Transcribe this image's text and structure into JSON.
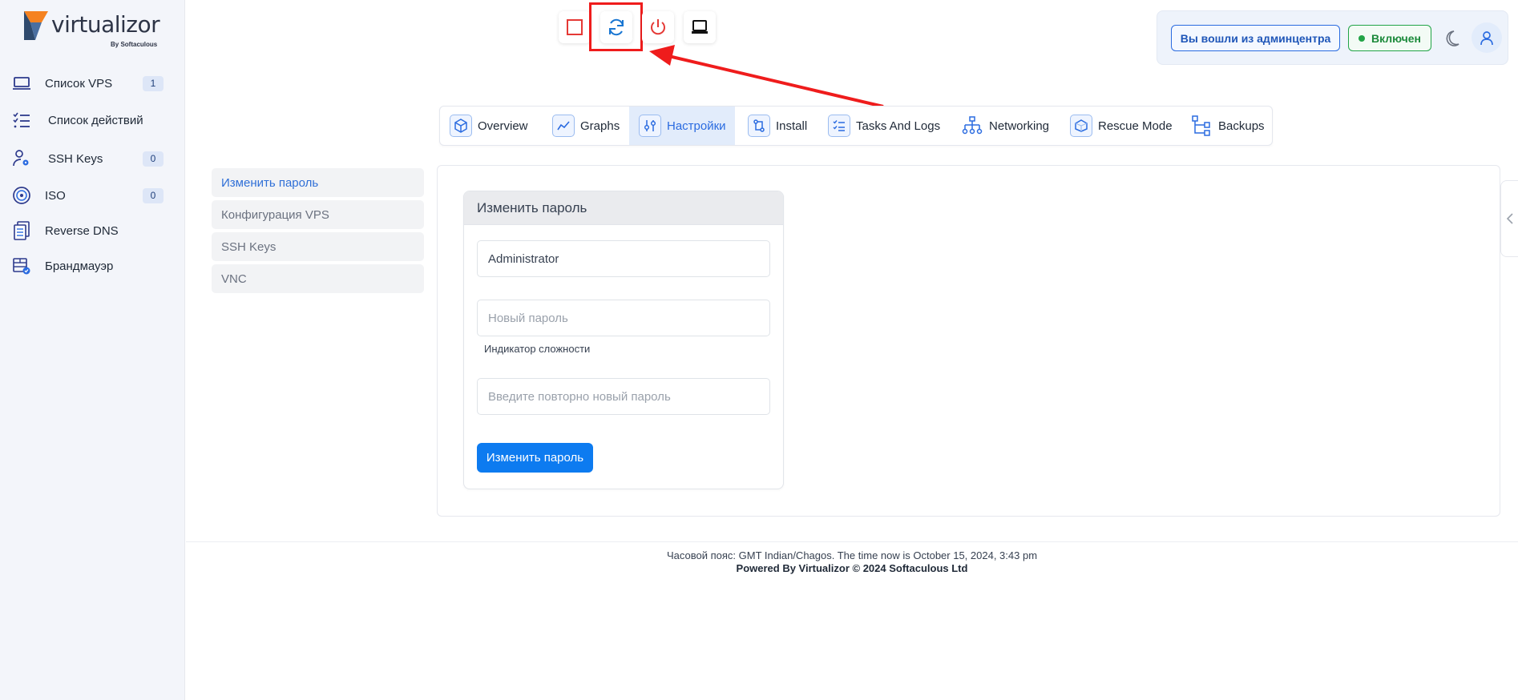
{
  "app": {
    "logo_text": "virtualizor",
    "logo_sub": "By Softaculous"
  },
  "sidebar": {
    "items": [
      {
        "label": "Список VPS",
        "icon": "laptop-icon",
        "badge": "1"
      },
      {
        "label": "Список действий",
        "icon": "task-list-icon",
        "badge": ""
      },
      {
        "label": "SSH Keys",
        "icon": "user-key-icon",
        "badge": "0"
      },
      {
        "label": "ISO",
        "icon": "disc-icon",
        "badge": "0"
      },
      {
        "label": "Reverse DNS",
        "icon": "documents-icon",
        "badge": ""
      },
      {
        "label": "Брандмауэр",
        "icon": "firewall-icon",
        "badge": ""
      }
    ]
  },
  "toolbar": {
    "actions": [
      "stop-icon",
      "restart-icon",
      "power-icon",
      "vnc-laptop-icon"
    ],
    "highlighted": "restart-icon"
  },
  "header": {
    "admin_login": "Вы вошли из админцентра",
    "status": "Включен",
    "status_color": "#22a447",
    "theme_icon": "moon-icon",
    "user_icon": "user-icon"
  },
  "tabs": [
    {
      "label": "Overview",
      "icon": "cube-icon"
    },
    {
      "label": "Graphs",
      "icon": "chart-line-icon"
    },
    {
      "label": "Настройки",
      "icon": "sliders-icon",
      "active": true
    },
    {
      "label": "Install",
      "icon": "install-icon"
    },
    {
      "label": "Tasks And Logs",
      "icon": "checklist-icon"
    },
    {
      "label": "Networking",
      "icon": "network-icon"
    },
    {
      "label": "Rescue Mode",
      "icon": "rescue-box-icon"
    },
    {
      "label": "Backups",
      "icon": "backup-tree-icon"
    }
  ],
  "settings_menu": [
    {
      "label": "Изменить пароль",
      "active": true
    },
    {
      "label": "Конфигурация VPS"
    },
    {
      "label": "SSH Keys"
    },
    {
      "label": "VNC"
    }
  ],
  "form": {
    "title": "Изменить пароль",
    "username_value": "Administrator",
    "new_password_placeholder": "Новый пароль",
    "strength_label": "Индикатор сложности",
    "repeat_password_placeholder": "Введите повторно новый пароль",
    "submit_label": "Изменить пароль"
  },
  "footer": {
    "timezone": "Часовой пояс: GMT Indian/Chagos. The time now is October 15, 2024, 3:43 pm",
    "powered": "Powered By Virtualizor © 2024 Softaculous Ltd"
  },
  "colors": {
    "accent": "#0d7bf0",
    "highlight": "#ef1c1c",
    "sidebar_bg": "#f3f5fa"
  }
}
